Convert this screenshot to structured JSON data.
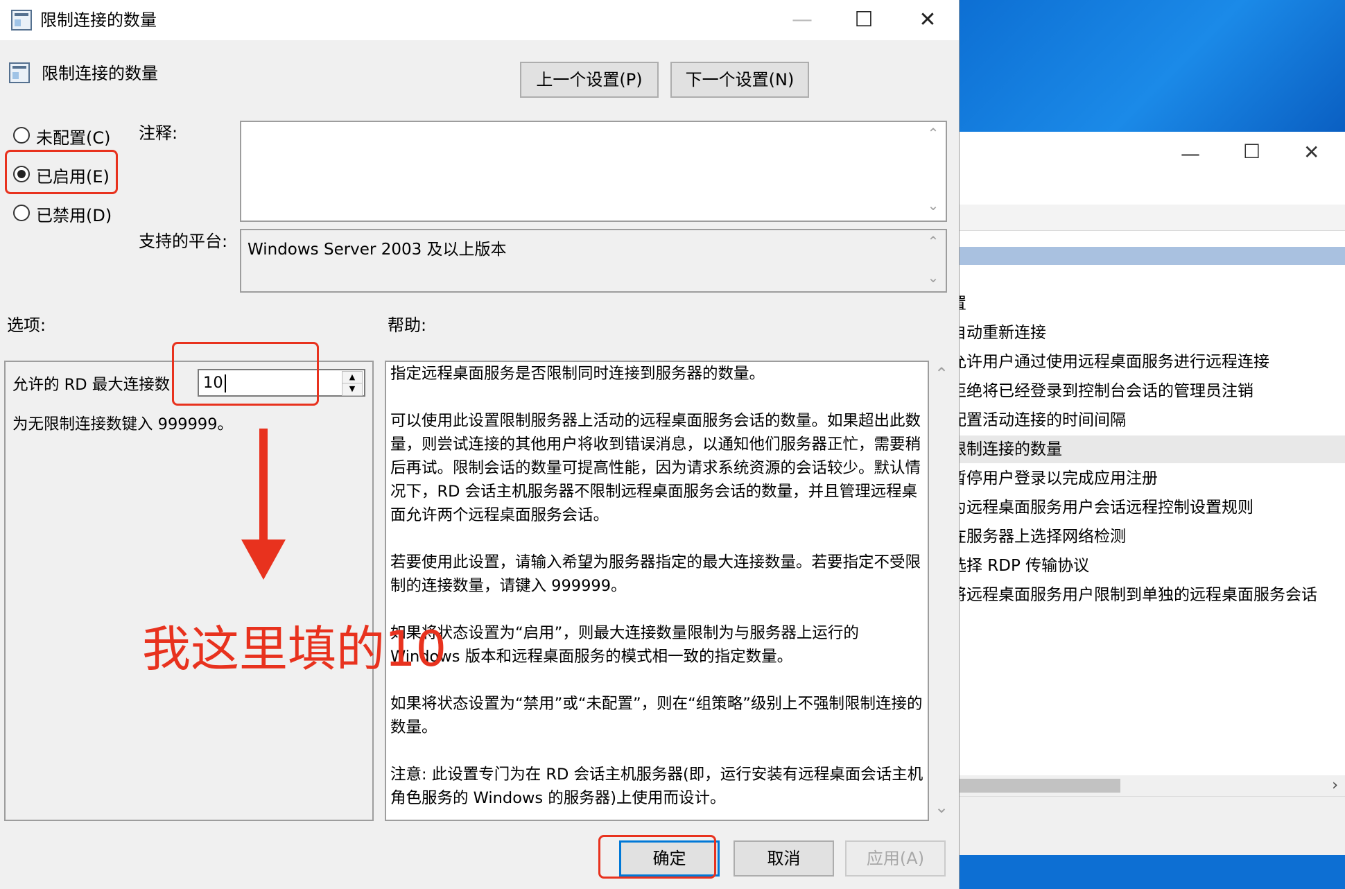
{
  "dialog": {
    "title": "限制连接的数量",
    "policy_name": "限制连接的数量",
    "prev_label": "上一个设置(P)",
    "next_label": "下一个设置(N)",
    "radios": [
      {
        "label": "未配置(C)",
        "selected": false
      },
      {
        "label": "已启用(E)",
        "selected": true
      },
      {
        "label": "已禁用(D)",
        "selected": false
      }
    ],
    "comment_label": "注释:",
    "comment_value": "",
    "platform_label": "支持的平台:",
    "platform_value": "Windows Server 2003 及以上版本",
    "options_label": "选项:",
    "help_label": "帮助:",
    "max_conn_label": "允许的 RD 最大连接数",
    "max_conn_value": "10",
    "unlimited_hint": "为无限制连接数键入 999999。",
    "help_paragraphs": [
      "指定远程桌面服务是否限制同时连接到服务器的数量。",
      "可以使用此设置限制服务器上活动的远程桌面服务会话的数量。如果超出此数量，则尝试连接的其他用户将收到错误消息，以通知他们服务器正忙，需要稍后再试。限制会话的数量可提高性能，因为请求系统资源的会话较少。默认情况下，RD 会话主机服务器不限制远程桌面服务会话的数量，并且管理远程桌面允许两个远程桌面服务会话。",
      "若要使用此设置，请输入希望为服务器指定的最大连接数量。若要指定不受限制的连接数量，请键入 999999。",
      "如果将状态设置为“启用”，则最大连接数量限制为与服务器上运行的 Windows 版本和远程桌面服务的模式相一致的指定数量。",
      "如果将状态设置为“禁用”或“未配置”，则在“组策略”级别上不强制限制连接的数量。",
      "注意: 此设置专门为在 RD 会话主机服务器(即，运行安装有远程桌面会话主机角色服务的 Windows 的服务器)上使用而设计。"
    ],
    "ok_label": "确定",
    "cancel_label": "取消",
    "apply_label": "应用(A)"
  },
  "annotation": {
    "text": "我这里填的10",
    "color": "#e8321e"
  },
  "background_window": {
    "items": [
      {
        "label": "置",
        "selected": false
      },
      {
        "label": "自动重新连接",
        "selected": false
      },
      {
        "label": "允许用户通过使用远程桌面服务进行远程连接",
        "selected": false
      },
      {
        "label": "拒绝将已经登录到控制台会话的管理员注销",
        "selected": false
      },
      {
        "label": "配置活动连接的时间间隔",
        "selected": false
      },
      {
        "label": "限制连接的数量",
        "selected": true
      },
      {
        "label": "暂停用户登录以完成应用注册",
        "selected": false
      },
      {
        "label": "为远程桌面服务用户会话远程控制设置规则",
        "selected": false
      },
      {
        "label": "在服务器上选择网络检测",
        "selected": false
      },
      {
        "label": "选择 RDP 传输协议",
        "selected": false
      },
      {
        "label": "将远程桌面服务用户限制到单独的远程桌面服务会话",
        "selected": false
      }
    ]
  },
  "colors": {
    "accent": "#0078d7",
    "annotation_red": "#e8321e",
    "dialog_bg": "#f0f0f0",
    "desktop_blue": "#0a74d8"
  }
}
